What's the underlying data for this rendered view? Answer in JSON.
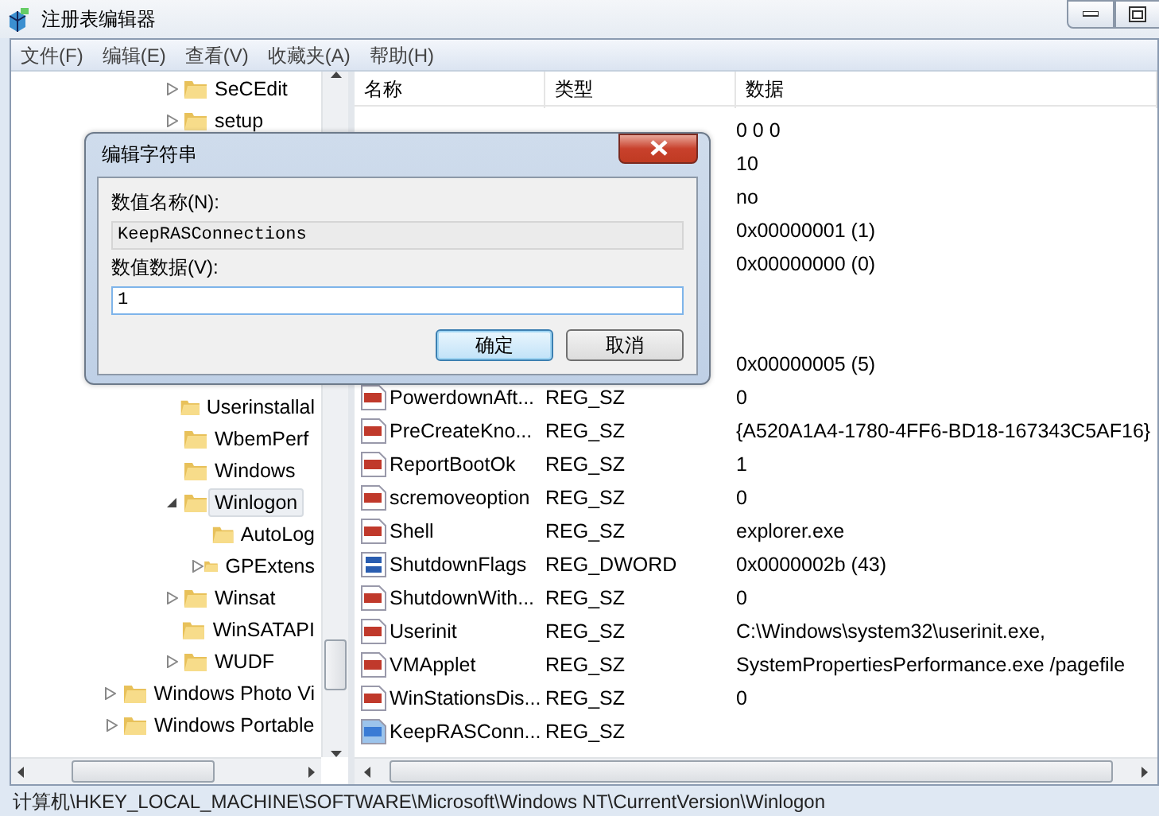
{
  "window": {
    "title": "注册表编辑器"
  },
  "menu": [
    "文件(F)",
    "编辑(E)",
    "查看(V)",
    "收藏夹(A)",
    "帮助(H)"
  ],
  "tree": {
    "items": [
      {
        "label": "SeCEdit",
        "expanded": false,
        "selected": false
      },
      {
        "label": "setup",
        "expanded": false,
        "selected": false
      },
      {
        "label": "Userinstallal",
        "selected": false
      },
      {
        "label": "WbemPerf",
        "selected": false
      },
      {
        "label": "Windows",
        "selected": false
      },
      {
        "label": "Winlogon",
        "expanded": true,
        "selected": true,
        "children": [
          {
            "label": "AutoLog",
            "selected": false
          },
          {
            "label": "GPExtens",
            "expanded": false,
            "selected": false
          }
        ]
      },
      {
        "label": "Winsat",
        "expanded": false,
        "selected": false
      },
      {
        "label": "WinSATAPI",
        "selected": false
      },
      {
        "label": "WUDF",
        "expanded": false,
        "selected": false
      }
    ],
    "outer_items": [
      {
        "label": "Windows Photo Vi",
        "expanded": false,
        "selected": false
      },
      {
        "label": "Windows Portable",
        "expanded": false,
        "selected": false
      }
    ]
  },
  "table": {
    "columns": [
      "名称",
      "类型",
      "数据"
    ],
    "rows": [
      {
        "data": "0 0 0"
      },
      {
        "data": "10"
      },
      {
        "data": "no"
      },
      {
        "data": "0x00000001 (1)"
      },
      {
        "data": "0x00000000 (0)"
      },
      {
        "data": "0x00000005 (5)"
      },
      {
        "name": "PowerdownAft...",
        "type": "REG_SZ",
        "data": "0",
        "kind": "sz",
        "selected": false
      },
      {
        "name": "PreCreateKno...",
        "type": "REG_SZ",
        "data": "{A520A1A4-1780-4FF6-BD18-167343C5AF16}",
        "kind": "sz",
        "selected": false
      },
      {
        "name": "ReportBootOk",
        "type": "REG_SZ",
        "data": "1",
        "kind": "sz",
        "selected": false
      },
      {
        "name": "scremoveoption",
        "type": "REG_SZ",
        "data": "0",
        "kind": "sz",
        "selected": false
      },
      {
        "name": "Shell",
        "type": "REG_SZ",
        "data": "explorer.exe",
        "kind": "sz",
        "selected": false
      },
      {
        "name": "ShutdownFlags",
        "type": "REG_DWORD",
        "data": "0x0000002b (43)",
        "kind": "dword",
        "selected": false
      },
      {
        "name": "ShutdownWith...",
        "type": "REG_SZ",
        "data": "0",
        "kind": "sz",
        "selected": false
      },
      {
        "name": "Userinit",
        "type": "REG_SZ",
        "data": "C:\\Windows\\system32\\userinit.exe,",
        "kind": "sz",
        "selected": false
      },
      {
        "name": "VMApplet",
        "type": "REG_SZ",
        "data": "SystemPropertiesPerformance.exe /pagefile",
        "kind": "sz",
        "selected": false
      },
      {
        "name": "WinStationsDis...",
        "type": "REG_SZ",
        "data": "0",
        "kind": "sz",
        "selected": false
      },
      {
        "name": "KeepRASConn...",
        "type": "REG_SZ",
        "kind": "sz",
        "selected": true
      }
    ]
  },
  "dialog": {
    "title": "编辑字符串",
    "name_label": "数值名称(N):",
    "name_value": "KeepRASConnections",
    "data_label": "数值数据(V):",
    "data_value": "1",
    "buttons": [
      {
        "label": "确定",
        "default": true
      },
      {
        "label": "取消",
        "default": false
      }
    ]
  },
  "status_bar": "计算机\\HKEY_LOCAL_MACHINE\\SOFTWARE\\Microsoft\\Windows NT\\CurrentVersion\\Winlogon"
}
